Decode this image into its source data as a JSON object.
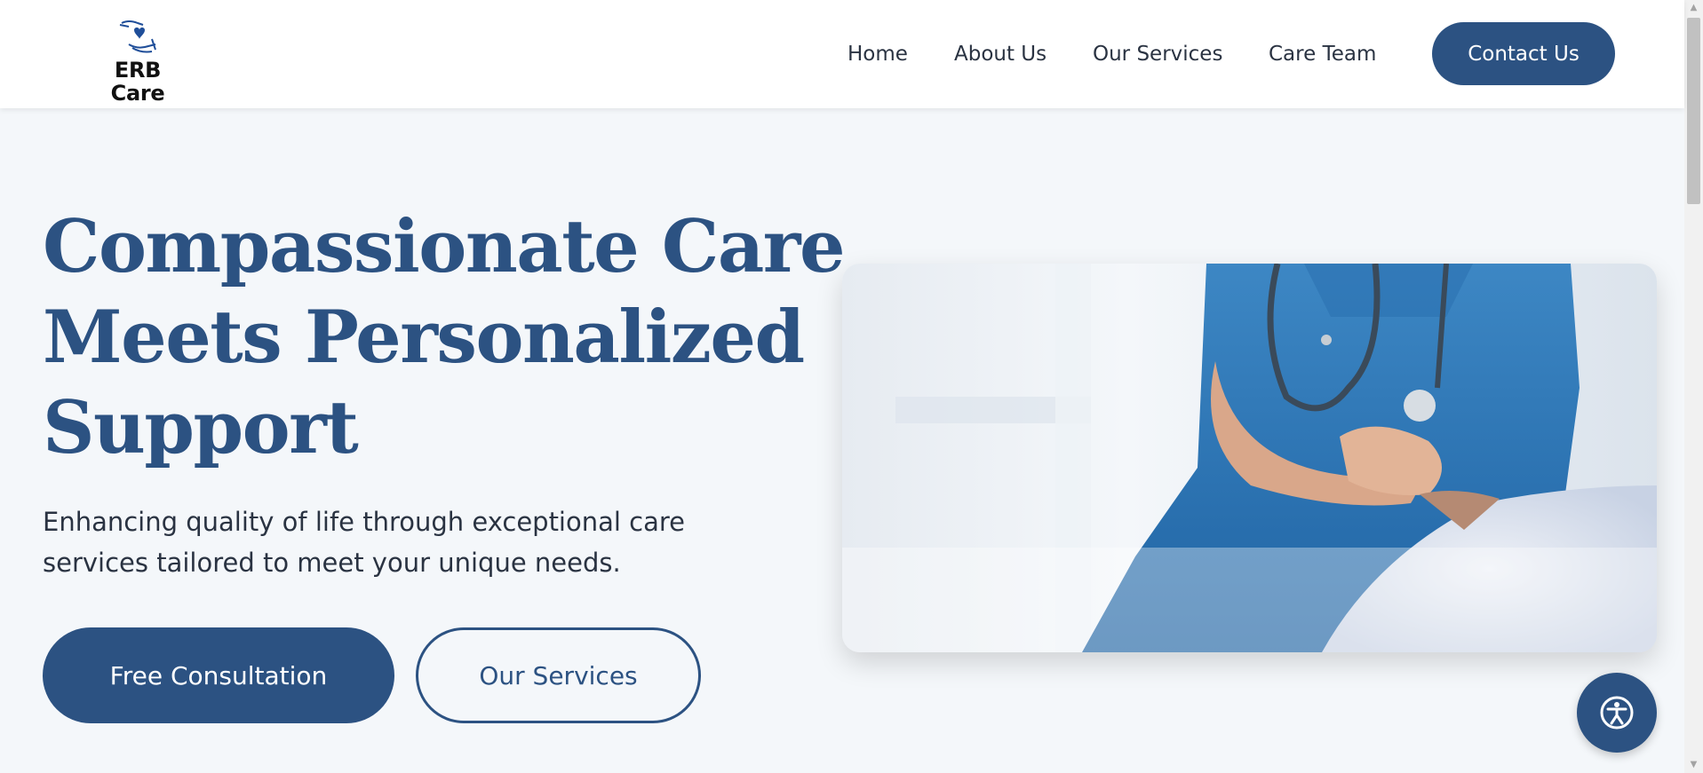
{
  "brand": {
    "name": "ERB Care",
    "logo_icon": "hands-heart-icon",
    "accent_color": "#2c5282"
  },
  "nav": {
    "items": [
      {
        "label": "Home"
      },
      {
        "label": "About Us"
      },
      {
        "label": "Our Services"
      },
      {
        "label": "Care Team"
      }
    ],
    "cta_label": "Contact Us"
  },
  "hero": {
    "title_lines": [
      "Compassionate Care",
      "Meets Personalized",
      "Support"
    ],
    "subtitle_lines": [
      "Enhancing quality of life through exceptional care",
      "services tailored to meet your unique needs."
    ],
    "primary_button": "Free Consultation",
    "secondary_button": "Our Services",
    "image_icon": "nurse-holding-patient-hands-photo"
  },
  "accessibility": {
    "icon": "accessibility-icon"
  }
}
